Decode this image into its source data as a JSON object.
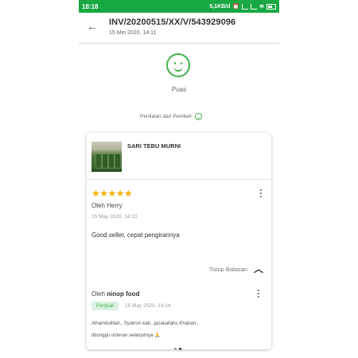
{
  "status_bar": {
    "time": "18:18",
    "network": "5,1KB/d"
  },
  "header": {
    "back_icon": "arrow-left-icon",
    "invoice_number": "INV/20200515/XX/V/543929096",
    "invoice_date": "15 Mei 2020, 14:11"
  },
  "rating_summary": {
    "icon": "smiley-icon",
    "label": "Puas",
    "section_label": "Penilaian dari Pembeli",
    "accent_color": "#41b24b"
  },
  "review_card": {
    "product_name": "SARI TEBU MURNI",
    "stars": "★★★★★",
    "star_color": "#f3b400",
    "reviewer": "Oleh Herry",
    "review_date": "15 May 2020, 14:13",
    "review_text": "Good seller, cepat pengirannya",
    "collapse_label": "Tutup Balasan",
    "reply": {
      "prefix": "Oleh",
      "author": "ninop food",
      "badge": "Penjual",
      "date": "15 May 2020, 14:14",
      "line1": "Alhamdulillah.. Syukron kak.. jazakallahu Khairan..",
      "line2": "ditunggu orderan selanjutnya 🙏"
    }
  }
}
